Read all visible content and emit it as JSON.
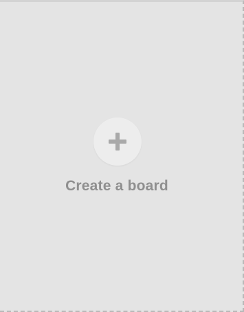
{
  "board_card": {
    "label": "Create a board",
    "icon": "plus-icon"
  },
  "colors": {
    "card_background": "#e4e4e4",
    "circle_background": "#ededed",
    "icon_color": "#a9a9a9",
    "label_color": "#8f8f8f",
    "dashed_border": "#b9b9b9"
  }
}
